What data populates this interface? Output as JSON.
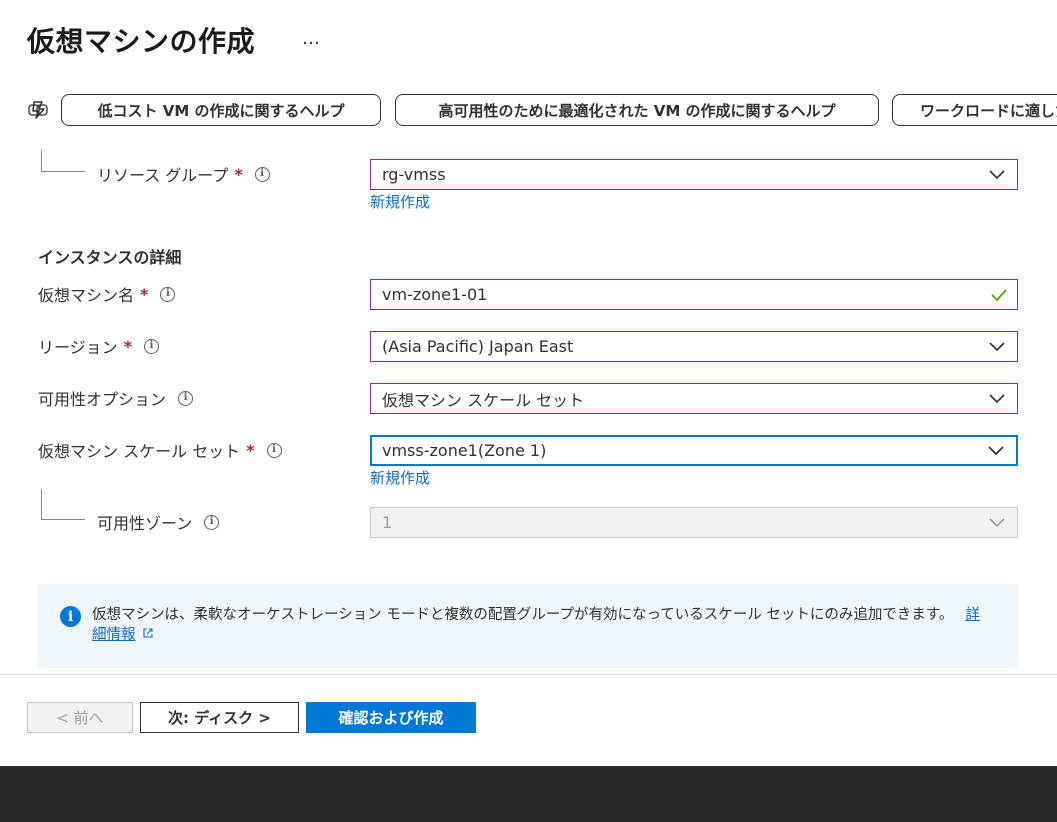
{
  "page": {
    "title": "仮想マシンの作成",
    "more_label": "…"
  },
  "suggestions": [
    {
      "label": "低コスト VM の作成に関するヘルプ"
    },
    {
      "label": "高可用性のために最適化された VM の作成に関するヘルプ"
    },
    {
      "label": "ワークロードに適した VM の作成に関するヘルプ"
    }
  ],
  "resource_group": {
    "label": "リソース グループ",
    "required": "*",
    "value": "rg-vmss",
    "create_new": "新規作成"
  },
  "instance": {
    "section_title": "インスタンスの詳細",
    "vm_name": {
      "label": "仮想マシン名",
      "required": "*",
      "value": "vm-zone1-01"
    },
    "region": {
      "label": "リージョン",
      "required": "*",
      "value": "(Asia Pacific) Japan East"
    },
    "availability_option": {
      "label": "可用性オプション",
      "value": "仮想マシン スケール セット"
    },
    "scale_set": {
      "label": "仮想マシン スケール セット",
      "required": "*",
      "value": "vmss-zone1(Zone 1)",
      "create_new": "新規作成"
    },
    "availability_zone": {
      "label": "可用性ゾーン",
      "value": "1"
    }
  },
  "info_banner": {
    "message": "仮想マシンは、柔軟なオーケストレーション モードと複数の配置グループが有効になっているスケール セットにのみ追加できます。",
    "link": "詳細情報"
  },
  "footer": {
    "prev_label": "< 前へ",
    "next_label": "次: ディスク >",
    "review_label": "確認および作成"
  },
  "colors": {
    "accent": "#0078d4",
    "required": "#a4262c",
    "field_border": "#8c2c8a",
    "info_bg": "#eff6fc",
    "valid_check": "#57a300"
  }
}
